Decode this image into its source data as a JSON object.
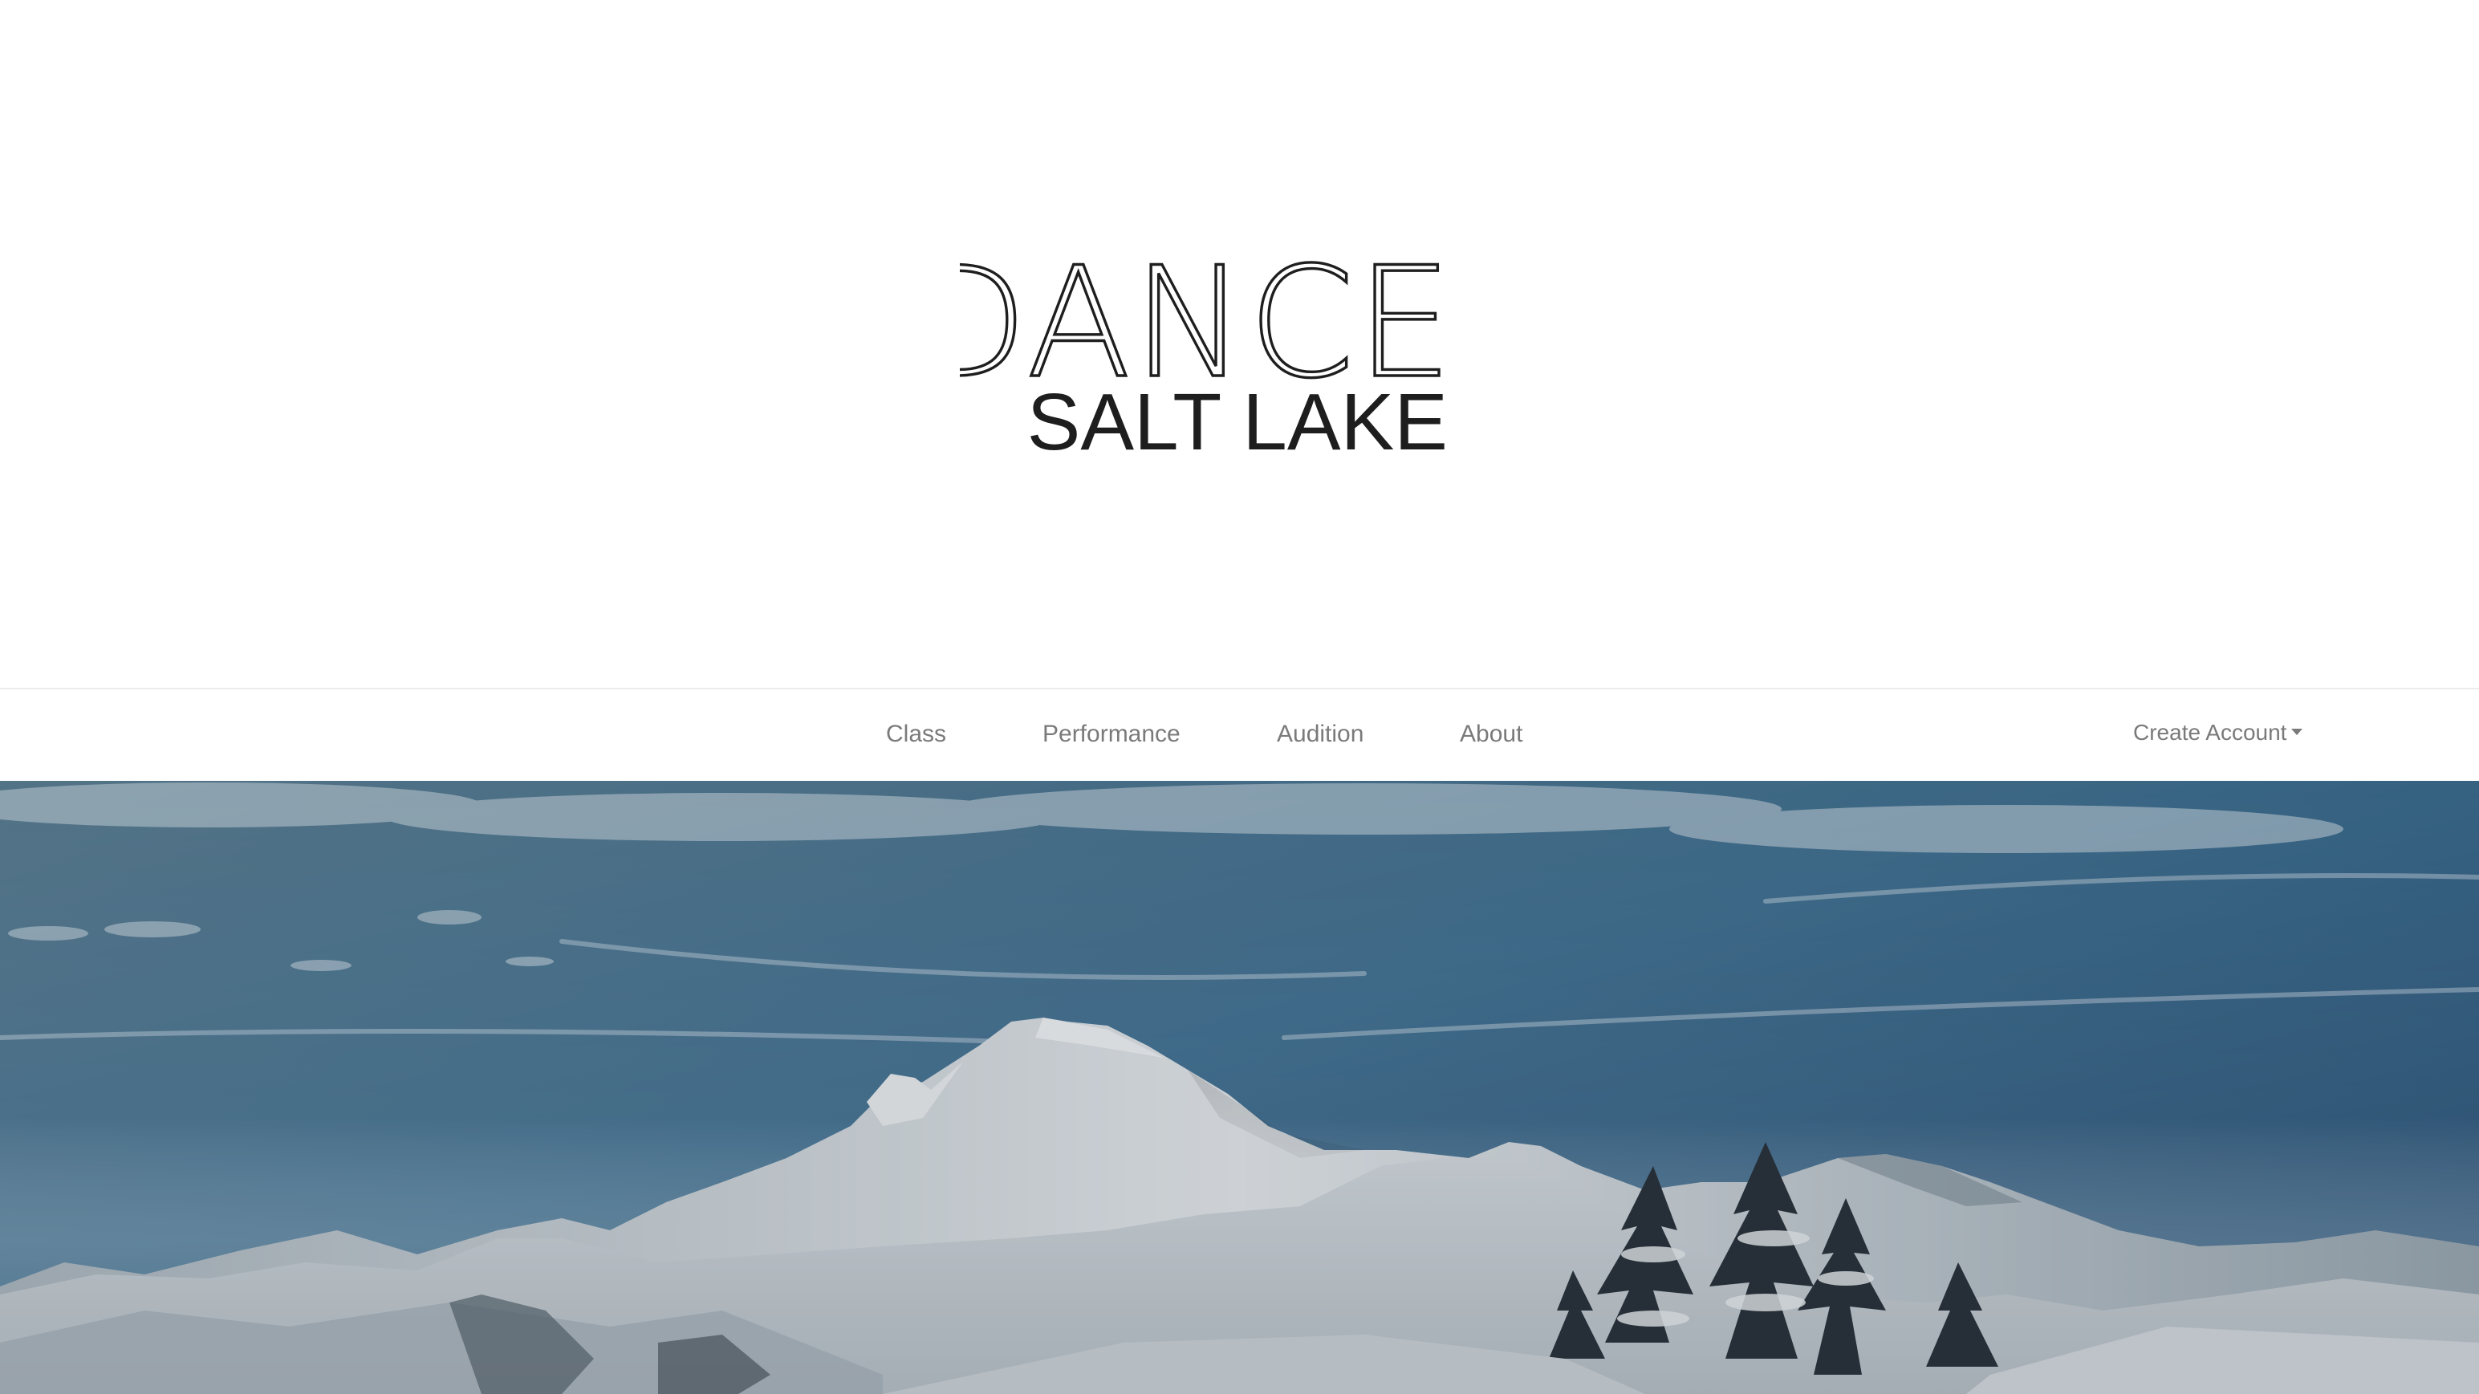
{
  "logo": {
    "line1": "DANCE",
    "line2": "SALT LAKE",
    "color": "#1e1e1e"
  },
  "nav": {
    "items": [
      {
        "label": "Class"
      },
      {
        "label": "Performance"
      },
      {
        "label": "Audition"
      },
      {
        "label": "About"
      }
    ],
    "account_label": "Create Account"
  },
  "colors": {
    "nav_text": "#7a7a7a",
    "sky_top": "#1f4a72",
    "sky_mid": "#4a7998",
    "snow": "#dfe3e6"
  },
  "icons": {
    "account_dropdown": "caret-down-icon"
  }
}
